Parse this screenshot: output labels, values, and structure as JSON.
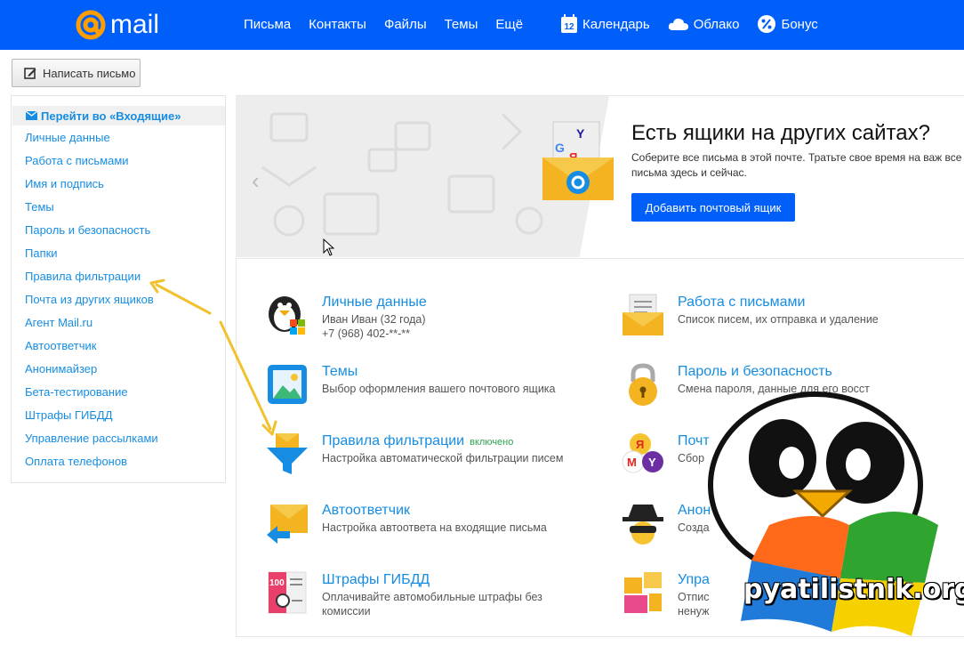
{
  "topbar": {
    "logo_text": "mail",
    "nav": [
      "Письма",
      "Контакты",
      "Файлы",
      "Темы",
      "Ещё"
    ],
    "calendar_label": "Календарь",
    "calendar_day": "12",
    "cloud_label": "Облако",
    "bonus_label": "Бонус",
    "accent": "#005ff9"
  },
  "compose_label": "Написать письмо",
  "sidebar": {
    "inbox_link": "Перейти во «Входящие»",
    "items": [
      "Личные данные",
      "Работа с письмами",
      "Имя и подпись",
      "Темы",
      "Пароль и безопасность",
      "Папки",
      "Правила фильтрации",
      "Почта из других ящиков",
      "Агент Mail.ru",
      "Автоответчик",
      "Анонимайзер",
      "Бета-тестирование",
      "Штрафы ГИБДД",
      "Управление рассылками",
      "Оплата телефонов"
    ]
  },
  "banner": {
    "title": "Есть ящики на других сайтах?",
    "text": "Соберите все письма в этой почте. Тратьте свое время на важ все письма здесь и сейчас.",
    "button": "Добавить почтовый ящик",
    "prev_glyph": "‹"
  },
  "cards": [
    {
      "title": "Личные данные",
      "desc": "Иван Иван  (32 года)\n+7 (968) 402-**-**",
      "icon": "penguin-icon"
    },
    {
      "title": "Работа с письмами",
      "desc": "Список писем, их отправка и удаление",
      "icon": "envelope-letter-icon"
    },
    {
      "title": "Темы",
      "desc": "Выбор оформления вашего почтового ящика",
      "icon": "picture-icon"
    },
    {
      "title": "Пароль и безопасность",
      "desc": "Смена пароля, данные для его восст",
      "icon": "lock-icon"
    },
    {
      "title": "Правила фильтрации",
      "tag": "включено",
      "desc": "Настройка автоматической фильтрации писем",
      "icon": "funnel-icon"
    },
    {
      "title": "Почт",
      "desc": "Сбор",
      "icon": "mail-collector-icon"
    },
    {
      "title": "Автоответчик",
      "desc": "Настройка автоответа на входящие письма",
      "icon": "autoreply-icon"
    },
    {
      "title": "Анон",
      "desc": "Созда",
      "icon": "spy-icon"
    },
    {
      "title": "Штрафы ГИБДД",
      "desc": "Оплачивайте автомобильные штрафы без комиссии",
      "icon": "fine-ticket-icon",
      "ticket_text": "100 ₽"
    },
    {
      "title": "Упра",
      "desc": "Отпис\nненуж",
      "icon": "folders-icon"
    }
  ],
  "watermark": "pyatilistnik.org"
}
